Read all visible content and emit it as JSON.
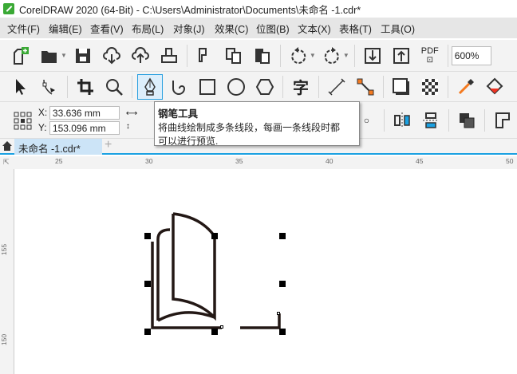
{
  "window": {
    "title": "CorelDRAW 2020 (64-Bit) - C:\\Users\\Administrator\\Documents\\未命名 -1.cdr*"
  },
  "menu": [
    "文件(F)",
    "编辑(E)",
    "查看(V)",
    "布局(L)",
    "对象(J)",
    "效果(C)",
    "位图(B)",
    "文本(X)",
    "表格(T)",
    "工具(O)"
  ],
  "toolbar": {
    "zoom": "600%",
    "pdf_label": "PDF"
  },
  "property_bar": {
    "x_label": "X:",
    "x_value": "33.636 mm",
    "y_label": "Y:",
    "y_value": "153.096 mm"
  },
  "tooltip": {
    "title": "钢笔工具",
    "body_line1": "将曲线绘制成多条线段，每画一条线段时都",
    "body_line2": "可以进行预览."
  },
  "tabs": {
    "document": "未命名 -1.cdr*",
    "add": "+"
  },
  "ruler": {
    "h": [
      "25",
      "30",
      "35",
      "40",
      "45",
      "50"
    ],
    "v": [
      "155",
      "150"
    ]
  },
  "colors": {
    "accent": "#1ba1e2",
    "logo": "#3aa935"
  }
}
